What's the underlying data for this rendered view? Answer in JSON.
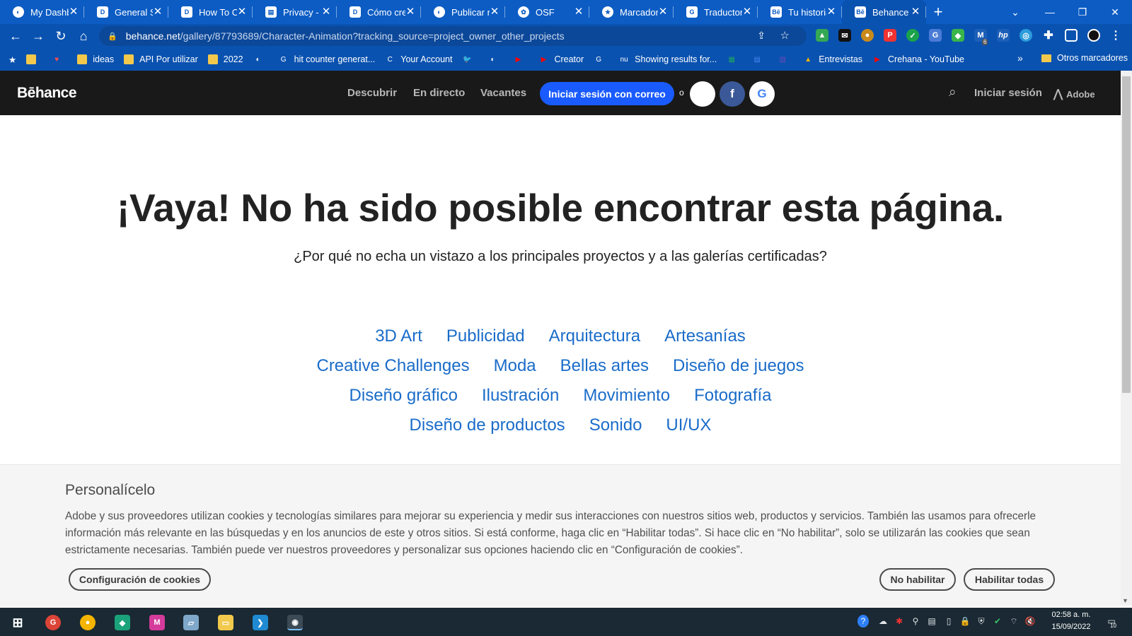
{
  "browser": {
    "tabs": [
      {
        "title": "My Dashb",
        "favicon": "globe-icon"
      },
      {
        "title": "General Se",
        "favicon": "d-app-icon"
      },
      {
        "title": "How To Cr",
        "favicon": "d-app-icon"
      },
      {
        "title": "Privacy - M",
        "favicon": "document-icon"
      },
      {
        "title": "Cómo crea",
        "favicon": "d-app-icon"
      },
      {
        "title": "Publicar re",
        "favicon": "globe-icon"
      },
      {
        "title": "OSF",
        "favicon": "osf-icon"
      },
      {
        "title": "Marcadore",
        "favicon": "star-icon"
      },
      {
        "title": "Traductor",
        "favicon": "translate-icon"
      },
      {
        "title": "Tu historia",
        "favicon": "behance-icon"
      },
      {
        "title": "Behance",
        "favicon": "behance-icon",
        "active": true
      }
    ],
    "url_host": "behance.net",
    "url_path": "/gallery/87793689/Character-Animation?tracking_source=project_owner_other_projects",
    "bookmarks": [
      {
        "label": "",
        "icon": "folder-icon"
      },
      {
        "label": "",
        "icon": "heart-icon"
      },
      {
        "label": "ideas",
        "icon": "folder-icon"
      },
      {
        "label": "API Por utilizar",
        "icon": "folder-icon"
      },
      {
        "label": "2022",
        "icon": "folder-icon"
      },
      {
        "label": "",
        "icon": "globe-icon"
      },
      {
        "label": "hit counter generat...",
        "icon": "google-icon"
      },
      {
        "label": "Your Account",
        "icon": "c-icon"
      },
      {
        "label": "",
        "icon": "twitter-icon"
      },
      {
        "label": "",
        "icon": "globe-icon"
      },
      {
        "label": "",
        "icon": "youtube-icon"
      },
      {
        "label": "Creator",
        "icon": "youtube-icon"
      },
      {
        "label": "",
        "icon": "google-icon"
      },
      {
        "label": "Showing results for...",
        "icon": "nu-icon"
      },
      {
        "label": "",
        "icon": "sheets-icon"
      },
      {
        "label": "",
        "icon": "docs-icon"
      },
      {
        "label": "",
        "icon": "forms-icon"
      },
      {
        "label": "Entrevistas",
        "icon": "drive-icon"
      },
      {
        "label": "Crehana - YouTube",
        "icon": "youtube-icon"
      }
    ],
    "bookmarks_overflow": "»",
    "other_bookmarks": "Otros marcadores",
    "extension_badge": "6"
  },
  "behance": {
    "logo": "Bēhance",
    "nav": [
      "Descubrir",
      "En directo",
      "Vacantes"
    ],
    "signin_email": "Iniciar sesión con correo",
    "or": "o",
    "signin": "Iniciar sesión",
    "adobe": "Adobe"
  },
  "page": {
    "title": "¡Vaya! No ha sido posible encontrar esta página.",
    "subtitle": "¿Por qué no echa un vistazo a los principales proyectos y a las galerías certificadas?",
    "category_rows": [
      [
        "3D Art",
        "Publicidad",
        "Arquitectura",
        "Artesanías"
      ],
      [
        "Creative Challenges",
        "Moda",
        "Bellas artes",
        "Diseño de juegos"
      ],
      [
        "Diseño gráfico",
        "Ilustración",
        "Movimiento",
        "Fotografía"
      ],
      [
        "Diseño de productos",
        "Sonido",
        "UI/UX"
      ]
    ]
  },
  "cookie": {
    "title": "Personalícelo",
    "text": "Adobe y sus proveedores utilizan cookies y tecnologías similares para mejorar su experiencia y medir sus interacciones con nuestros sitios web, productos y servicios. También las usamos para ofrecerle información más relevante en las búsquedas y en los anuncios de este y otros sitios. Si está conforme, haga clic en “Habilitar todas”. Si hace clic en “No habilitar”, solo se utilizarán las cookies que sean estrictamente necesarias. También puede ver nuestros proveedores y personalizar sus opciones haciendo clic en “Configuración de cookies”.",
    "settings": "Configuración de cookies",
    "reject": "No habilitar",
    "accept": "Habilitar todas"
  },
  "taskbar": {
    "time": "02:58 a. m.",
    "date": "15/09/2022",
    "notifications": "10"
  },
  "colors": {
    "browser_chrome": "#0c5cc4",
    "behance_header": "#191919",
    "signin_button": "#1a5bff",
    "category_link": "#1a6cc9",
    "cookie_bg": "#f5f5f5",
    "taskbar": "#1a2933"
  }
}
